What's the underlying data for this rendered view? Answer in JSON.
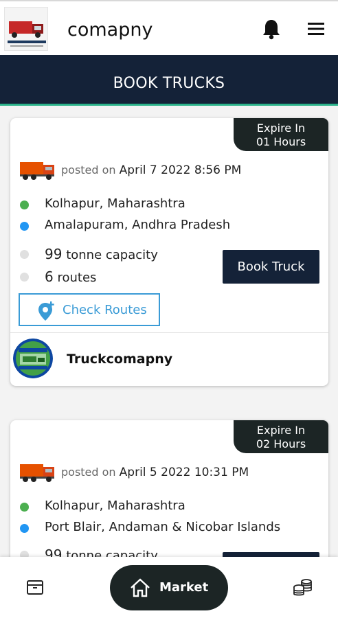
{
  "header": {
    "app_title": "comapny",
    "logo_icon": "truck-logo-icon",
    "notification_icon": "bell-icon",
    "menu_icon": "hamburger-menu-icon"
  },
  "banner": {
    "title": "BOOK TRUCKS"
  },
  "listings": [
    {
      "expire_line1": "Expire In",
      "expire_line2": "01 Hours",
      "posted_prefix": "posted on",
      "posted_date": "April 7 2022 8:56 PM",
      "origin": "Kolhapur,  Maharashtra",
      "destination": "Amalapuram,  Andhra Pradesh",
      "capacity_value": "99",
      "capacity_label": "tonne capacity",
      "routes_value": "6",
      "routes_label": "routes",
      "book_label": "Book Truck",
      "check_routes_label": "Check Routes",
      "company_name": "Truckcomapny"
    },
    {
      "expire_line1": "Expire In",
      "expire_line2": "02 Hours",
      "posted_prefix": "posted on",
      "posted_date": "April 5 2022 10:31 PM",
      "origin": "Kolhapur,  Maharashtra",
      "destination": "Port Blair,  Andaman & Nicobar Islands",
      "capacity_value": "99",
      "capacity_label": "tonne capacity"
    }
  ],
  "bottom_nav": {
    "left_icon": "box-icon",
    "market_label": "Market",
    "market_icon": "home-icon",
    "right_icon": "coins-icon"
  },
  "colors": {
    "navy": "#142238",
    "dark": "#1c2525",
    "accent_green": "#2bb38a",
    "origin_dot": "#4caf50",
    "destination_dot": "#2196f3",
    "link_blue": "#3a9bd6"
  }
}
